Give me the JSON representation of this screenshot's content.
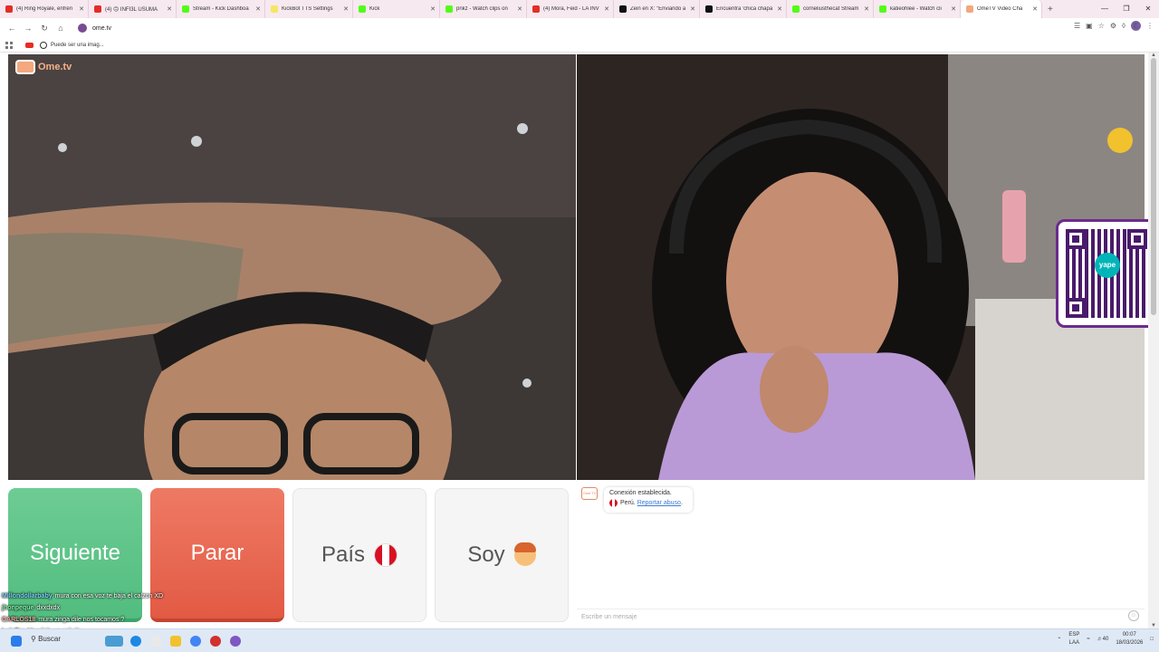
{
  "browser": {
    "tabs": [
      {
        "label": "(4) Ring Royale, enfren",
        "fav_color": "#e52d27"
      },
      {
        "label": "(4) 🙃 INFI3L USUMA",
        "fav_color": "#e52d27"
      },
      {
        "label": "Stream - Kick Dashboa",
        "fav_color": "#53fc18"
      },
      {
        "label": "KickBot TTS Settings",
        "fav_color": "#f5e663"
      },
      {
        "label": "Kick",
        "fav_color": "#53fc18"
      },
      {
        "label": "pnkz - Watch clips on",
        "fav_color": "#53fc18"
      },
      {
        "label": "(4) Mora, Feid - LA INV",
        "fav_color": "#e52d27"
      },
      {
        "label": "Zein en X: \"Enviando a",
        "fav_color": "#111111"
      },
      {
        "label": "Encuentra 'chica chapa",
        "fav_color": "#111111"
      },
      {
        "label": "corneliusthecat Stream",
        "fav_color": "#53fc18"
      },
      {
        "label": "katieohlee - Watch cli",
        "fav_color": "#53fc18"
      },
      {
        "label": "OmeTV Video Cha",
        "fav_color": "#f3a87d",
        "active": true
      }
    ],
    "url": "ome.tv",
    "bookmark_label": "Puede ser una imag...",
    "profile_initial": "E"
  },
  "page": {
    "logo_text": "Ome.tv",
    "qr_logo_text": "yape",
    "buttons": {
      "next_label": "Siguiente",
      "stop_label": "Parar",
      "country_label": "País",
      "gender_label": "Soy"
    },
    "chat": {
      "logo_text": "Ome TV",
      "connection_text": "Conexión establecida.",
      "country_text": "Perú.",
      "report_link": "Reportar abuso",
      "input_placeholder": "Escribe un mensaje"
    }
  },
  "stream_chat": [
    {
      "user": "Millondollarbaby",
      "message": "mura con esa voz te baja el calzon XD",
      "color": "#7dd3fc"
    },
    {
      "user": "jhonpeque",
      "message": "dxxdxdx",
      "color": "#86efac"
    },
    {
      "user": "CARLOS18",
      "message": "mura zinga dile nos tocamos ?",
      "color": "#fca5a5"
    },
    {
      "user": "LuisFer",
      "message": "Mandale un saludo",
      "color": "#fde68a"
    }
  ],
  "taskbar": {
    "search_label": "Buscar",
    "lang_top": "ESP",
    "lang_bottom": "LAA",
    "volume": "40",
    "time": "00:07",
    "date": "18/03/2026"
  }
}
